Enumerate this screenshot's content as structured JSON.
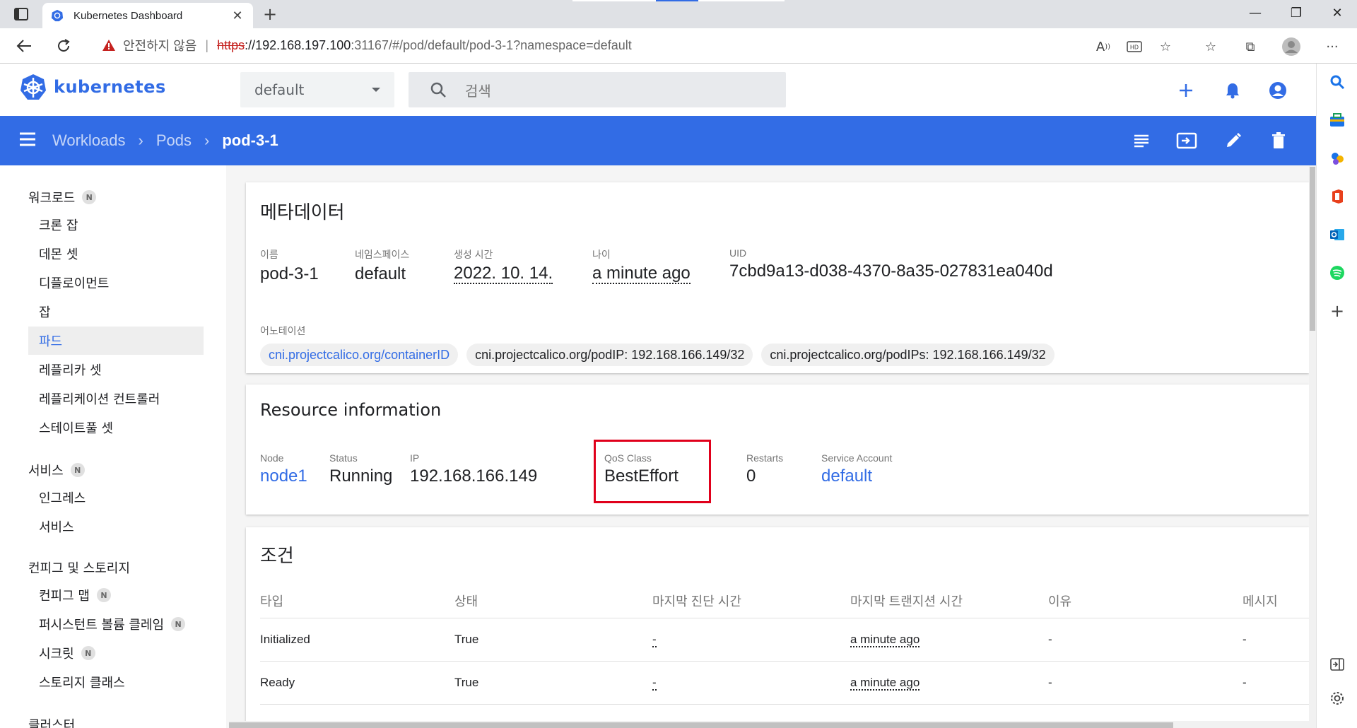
{
  "browser": {
    "tab_title": "Kubernetes Dashboard",
    "url_warning": "안전하지 않음",
    "url_scheme": "https",
    "url_host": "://192.168.197.100",
    "url_rest": ":31167/#/pod/default/pod-3-1?namespace=default"
  },
  "header": {
    "logo_text": "kubernetes",
    "namespace": "default",
    "search_placeholder": "검색"
  },
  "breadcrumb": {
    "items": [
      "Workloads",
      "Pods"
    ],
    "current": "pod-3-1"
  },
  "nav": {
    "workloads": "워크로드",
    "cronjobs": "크론 잡",
    "daemonsets": "데몬 셋",
    "deployments": "디플로이먼트",
    "jobs": "잡",
    "pods": "파드",
    "replicasets": "레플리카 셋",
    "replicationcontrollers": "레플리케이션 컨트롤러",
    "statefulsets": "스테이트풀 셋",
    "services_section": "서비스",
    "ingresses": "인그레스",
    "services": "서비스",
    "config_section": "컨피그 및 스토리지",
    "configmaps": "컨피그 맵",
    "pvcs": "퍼시스턴트 볼륨 클레임",
    "secrets": "시크릿",
    "storageclasses": "스토리지 클래스",
    "cluster_section": "클러스터",
    "badge": "N"
  },
  "metadata": {
    "title": "메타데이터",
    "name_label": "이름",
    "name": "pod-3-1",
    "ns_label": "네임스페이스",
    "ns": "default",
    "created_label": "생성 시간",
    "created": "2022. 10. 14.",
    "age_label": "나이",
    "age": "a minute ago",
    "uid_label": "UID",
    "uid": "7cbd9a13-d038-4370-8a35-027831ea040d",
    "annotations_label": "어노테이션",
    "annotations": [
      "cni.projectcalico.org/containerID",
      "cni.projectcalico.org/podIP: 192.168.166.149/32",
      "cni.projectcalico.org/podIPs: 192.168.166.149/32"
    ]
  },
  "resource": {
    "title": "Resource information",
    "node_label": "Node",
    "node": "node1",
    "status_label": "Status",
    "status": "Running",
    "ip_label": "IP",
    "ip": "192.168.166.149",
    "qos_label": "QoS Class",
    "qos": "BestEffort",
    "restarts_label": "Restarts",
    "restarts": "0",
    "sa_label": "Service Account",
    "sa": "default",
    "highlight_color": "#e0001b"
  },
  "conditions": {
    "title": "조건",
    "columns": [
      "타입",
      "상태",
      "마지막 진단 시간",
      "마지막 트랜지션 시간",
      "이유",
      "메시지"
    ],
    "rows": [
      [
        "Initialized",
        "True",
        "-",
        "a minute ago",
        "-",
        "-"
      ],
      [
        "Ready",
        "True",
        "-",
        "a minute ago",
        "-",
        "-"
      ]
    ]
  },
  "colors": {
    "brand": "#326ce5"
  }
}
